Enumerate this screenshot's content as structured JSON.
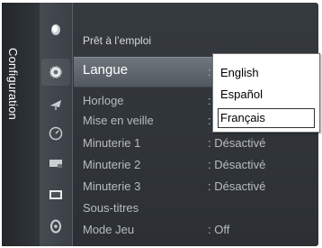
{
  "sidebar": {
    "title": "Configuration"
  },
  "icons": [
    {
      "name": "picture-icon"
    },
    {
      "name": "setup-gear-icon",
      "active": true
    },
    {
      "name": "satellite-dish-icon"
    },
    {
      "name": "timer-clock-icon"
    },
    {
      "name": "input-source-icon"
    },
    {
      "name": "screen-icon"
    },
    {
      "name": "support-disc-icon"
    }
  ],
  "menu": {
    "header": "Prêt à l’emploi",
    "items": [
      {
        "label": "Langue",
        "value": ":"
      },
      {
        "label": "Horloge",
        "value": ":"
      },
      {
        "label": "Mise en veille",
        "value": ":"
      },
      {
        "label": "Minuterie 1",
        "value": ": Désactivé"
      },
      {
        "label": "Minuterie 2",
        "value": ": Désactivé"
      },
      {
        "label": "Minuterie 3",
        "value": ": Désactivé"
      },
      {
        "label": "Sous-titres",
        "value": ""
      },
      {
        "label": "Mode Jeu",
        "value": ": Off"
      }
    ]
  },
  "language_dropdown": {
    "options": [
      "English",
      "Español",
      "Français"
    ],
    "selected": "Français"
  },
  "colors": {
    "panel": "#2c3035",
    "highlight": "#6e757c",
    "text": "#b7bcc1",
    "dropdown_bg": "#ffffff"
  }
}
